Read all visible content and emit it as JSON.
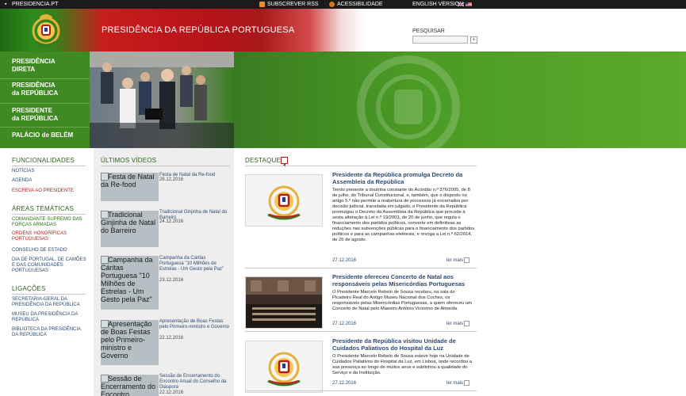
{
  "topbar": {
    "site": "PRESIDENCIA.PT",
    "rss": "SUBSCREVER RSS",
    "accessibility": "ACESSIBILIDADE",
    "english": "ENGLISH VERSION"
  },
  "header": {
    "title": "PRESIDÊNCIA DA REPÚBLICA PORTUGUESA",
    "search_label": "PESQUISAR",
    "search_button": "+"
  },
  "leftnav": [
    {
      "line1": "PRESIDÊNCIA",
      "line2": "DIRETA"
    },
    {
      "line1": "PRESIDÊNCIA",
      "line2": "da REPÚBLICA"
    },
    {
      "line1": "PRESIDENTE",
      "line2": "da REPÚBLICA"
    },
    {
      "line1": "PALÁCIO de BELÉM",
      "line2": ""
    }
  ],
  "funcionalidades": {
    "heading": "FUNCIONALIDADES",
    "items": [
      "NOTÍCIAS",
      "AGENDA",
      "ESCREVA AO PRESIDENTE"
    ]
  },
  "areas": {
    "heading": "ÁREAS TEMÁTICAS",
    "items": [
      "COMANDANTE SUPREMO DAS FORÇAS ARMADAS",
      "ORDENS HONORÍFICAS PORTUGUESAS",
      "CONSELHO DE ESTADO",
      "DIA DE PORTUGAL, DE CAMÕES E DAS COMUNIDADES PORTUGUESAS"
    ]
  },
  "ligacoes": {
    "heading": "LIGAÇÕES",
    "items": [
      "SECRETARIA-GERAL DA PRESIDÊNCIA DA REPÚBLICA",
      "MUSEU DA PRESIDÊNCIA DA REPÚBLICA",
      "BIBLIOTECA DA PRESIDÊNCIA DA REPÚBLICA"
    ]
  },
  "videos": {
    "heading": "ÚLTIMOS VÍDEOS",
    "items": [
      {
        "thumb": "Festa de Natal da Re-food",
        "title": "Festa de Natal da Re-food",
        "date": "26.12.2016"
      },
      {
        "thumb": "Tradicional Ginjinha de Natal do Barreiro",
        "title": "Tradicional Ginjinha de Natal do Barreiro",
        "date": "24.12.2016"
      },
      {
        "thumb": "Campanha da Cáritas Portuguesa \"10 Milhões de Estrelas - Um Gesto pela Paz\"",
        "title": "Campanha da Cáritas Portuguesa \"10 Milhões de Estrelas - Um Gesto pela Paz\"",
        "date": "23.12.2016"
      },
      {
        "thumb": "Apresentação de Boas Festas pelo Primeiro-ministro e Governo",
        "title": "Apresentação de Boas Festas pelo Primeiro-ministro e Governo",
        "date": "22.12.2016"
      },
      {
        "thumb": "Sessão de Encerramento do Encontro",
        "title": "Sessão de Encerramento do Encontro Anual do Conselho da Diáspora",
        "date": "22.12.2016"
      }
    ]
  },
  "destaque": {
    "heading": "DESTAQUE",
    "more_label": "ler mais",
    "items": [
      {
        "title": "Presidente da República promulga Decreto da Assembleia da República",
        "body": "Tendo presente a doutrina constante do Acórdão n.º 376/2005, de 8 de julho, do Tribunal Constitucional, e, também, que o disposto no artigo 5.º não permite a reabertura de processos já encerrados por decisão judicial, transitada em julgado, o Presidente da República promulgou o Decreto da Assembleia da República que procede à sexta alteração à Lei n.º 19/2003, de 20 de junho, que regula o financiamento dos partidos políticos, converte em definitivas as reduções nas subvenções públicas para o financiamento dos partidos políticos e para as campanhas eleitorais, e revoga a Lei n.º 62/2014, de 26 de agosto.",
        "date": "27.12.2016"
      },
      {
        "title": "Presidente ofereceu Concerto de Natal aos responsáveis pelas Misericórdias Portuguesas",
        "body": "O Presidente Marcelo Rebelo de Sousa recebeu, na sala do Picadeiro Real do Antigo Museu Nacional dos Coches, os responsáveis pelas Misericórdias Portuguesas, a quem ofereceu um Concerto de Natal pelo Maestro António Victorino de Almeida.",
        "date": "27.12.2016"
      },
      {
        "title": "Presidente da República visitou Unidade de Cuidados Paliativos do Hospital da Luz",
        "body": "O Presidente Marcelo Rebelo de Sousa esteve hoje na Unidade de Cuidados Paliativos do Hospital da Luz, em Lisboa, onde recordou a sua presença ao longo de muitos anos e sublinhou a qualidade do Serviço e da Instituição.",
        "date": "27.12.2016"
      }
    ]
  }
}
